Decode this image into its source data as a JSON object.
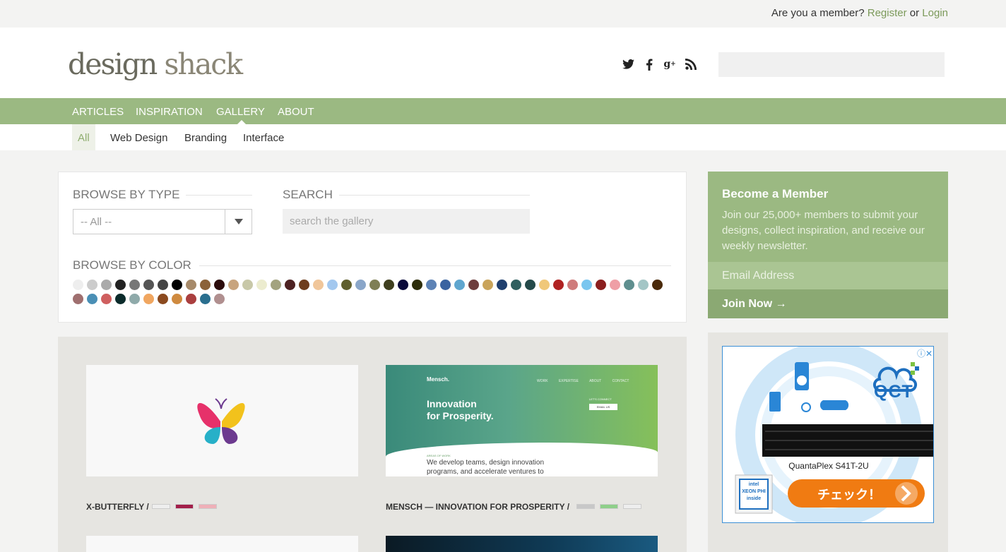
{
  "topbar": {
    "question": "Are you a member?",
    "register": "Register",
    "or": "or",
    "login": "Login"
  },
  "logo": {
    "part1": "design",
    "part2": "shack"
  },
  "social": [
    {
      "icon": "twitter-icon",
      "glyph": "🐦"
    },
    {
      "icon": "facebook-icon",
      "glyph": "f"
    },
    {
      "icon": "google-plus-icon",
      "glyph": "g⁺"
    },
    {
      "icon": "rss-icon",
      "glyph": "◔"
    }
  ],
  "nav": {
    "items": [
      "ARTICLES",
      "INSPIRATION",
      "GALLERY",
      "ABOUT"
    ],
    "active": "GALLERY"
  },
  "subnav": {
    "items": [
      "All",
      "Web Design",
      "Branding",
      "Interface"
    ],
    "active": "All"
  },
  "filter": {
    "browse_type_label": "BROWSE BY TYPE",
    "type_value": "-- All --",
    "search_label": "SEARCH",
    "search_placeholder": "search the gallery",
    "browse_color_label": "BROWSE BY COLOR",
    "colors": [
      "#eeeeee",
      "#cccccc",
      "#aaaaaa",
      "#222222",
      "#777777",
      "#555555",
      "#444444",
      "#000000",
      "#a68a6a",
      "#8b6239",
      "#2c0b0b",
      "#c8a47e",
      "#c8c8a8",
      "#ececcf",
      "#a3a37f",
      "#4e2222",
      "#6e3d1d",
      "#f0c69a",
      "#a3c8ef",
      "#5f5f2e",
      "#8aa6c9",
      "#7f7f55",
      "#3f3f1f",
      "#0b0b3b",
      "#2e2e0b",
      "#5c82b5",
      "#3a63a0",
      "#5fa6cf",
      "#6d3e3e",
      "#c9a45b",
      "#1f3f6f",
      "#2f5f5f",
      "#244a4a",
      "#f0c87a",
      "#b02222",
      "#cf7b7b",
      "#7ac6ef",
      "#8b1f1f",
      "#ef9fa6",
      "#5f8f8f",
      "#a3c6c6",
      "#4a2a0b",
      "#9f6f6f",
      "#4a8fb5",
      "#cf5f5f",
      "#0b2b2b",
      "#8faaaa",
      "#f0a660",
      "#8b4a1f",
      "#cf8a3f",
      "#aa3f3f",
      "#2a6f8f",
      "#b08f8f"
    ]
  },
  "member": {
    "title": "Become a Member",
    "text": "Join our 25,000+ members to submit your designs, collect inspiration, and receive our weekly newsletter.",
    "email_placeholder": "Email Address",
    "join_label": "Join Now →"
  },
  "ad": {
    "brand": "QCT",
    "product": "QuantaPlex S41T-2U",
    "cta": "チェック！",
    "chip_lines": [
      "intel",
      "XEON PHI",
      "inside"
    ],
    "controls": "ⓘ✕"
  },
  "gallery": {
    "cards": [
      {
        "title": "X-BUTTERFLY /",
        "colors": [
          "#eeeeee",
          "#a31f4a",
          "#efb0b8"
        ]
      },
      {
        "title": "MENSCH — INNOVATION FOR PROSPERITY /",
        "colors": [
          "#c8c8c8",
          "#8fcf8a",
          "#eeeeee"
        ],
        "brand": "Mensch.",
        "headline1": "Innovation",
        "headline2": "for Prosperity.",
        "nav": [
          "WORK",
          "EXPERTISE",
          "ABOUT",
          "CONTACT"
        ],
        "connect": "LET'S CONNECT",
        "button": "EMAIL US",
        "area": "AREAS OF WORK",
        "body1": "We develop teams, design innovation",
        "body2": "programs, and accelerate ventures to"
      }
    ]
  }
}
